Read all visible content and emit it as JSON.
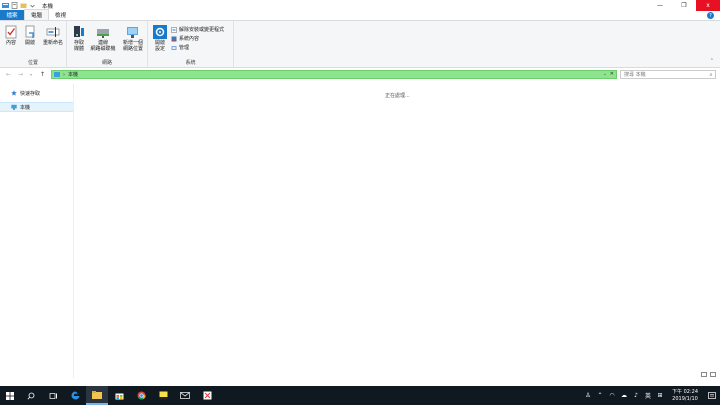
{
  "window": {
    "title": "本機",
    "minimize": "—",
    "maximize": "❐",
    "close": "x"
  },
  "tabs": [
    {
      "label": "檔案"
    },
    {
      "label": "電腦"
    },
    {
      "label": "檢視"
    }
  ],
  "ribbon": {
    "location": {
      "label": "位置",
      "properties": "內容",
      "open": "開啟",
      "rename": "重新命名"
    },
    "network": {
      "label": "網路",
      "access_media": [
        "存取",
        "媒體"
      ],
      "map_drive": [
        "連線",
        "網路磁碟機"
      ],
      "add_location": [
        "新增一個",
        "網路位置"
      ]
    },
    "system": {
      "label": "系統",
      "open_settings": [
        "開啟",
        "設定"
      ],
      "uninstall": "解除安裝或變更程式",
      "sys_props": "系統內容",
      "manage": "管理"
    }
  },
  "address": {
    "path": "本機",
    "separator": "›"
  },
  "search": {
    "placeholder": "搜尋 本機"
  },
  "navpane": {
    "quick_access": "快速存取",
    "this_pc": "本機"
  },
  "content": {
    "status": "正在處理..."
  },
  "taskbar": {
    "lang": "英",
    "time": "下午 02:24",
    "date": "2019/1/10"
  },
  "colors": {
    "accent": "#1979ca",
    "address_bg": "#8ee48e",
    "close": "#e81123",
    "taskbar": "#101820"
  }
}
